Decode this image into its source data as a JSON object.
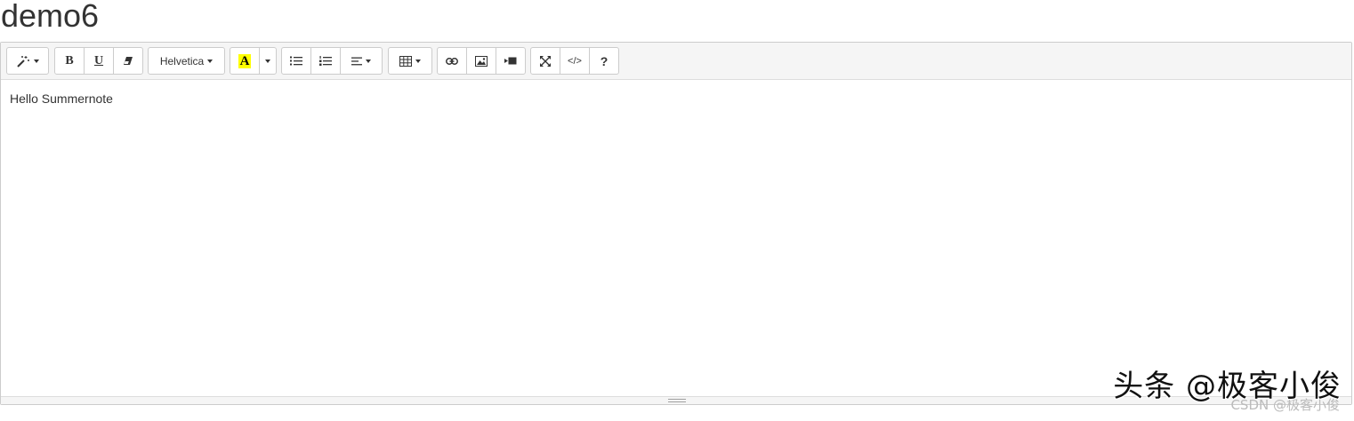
{
  "page": {
    "title": "demo6"
  },
  "toolbar": {
    "style_button": {
      "icon": "magic-wand-icon"
    },
    "bold_label": "B",
    "underline_label": "U",
    "clear_format": {
      "icon": "eraser-icon"
    },
    "font_name": "Helvetica",
    "color_label": "A",
    "color_highlight": "#ffff00",
    "unordered_list": {
      "icon": "list-ul-icon"
    },
    "ordered_list": {
      "icon": "list-ol-icon"
    },
    "paragraph": {
      "icon": "align-left-icon"
    },
    "table": {
      "icon": "table-icon"
    },
    "link": {
      "icon": "link-icon"
    },
    "picture": {
      "icon": "picture-icon"
    },
    "video": {
      "icon": "video-icon"
    },
    "fullscreen": {
      "icon": "arrows-expand-icon"
    },
    "codeview_label": "</>",
    "help_label": "?"
  },
  "editor": {
    "content": "Hello Summernote"
  },
  "watermark": {
    "main": "头条 @极客小俊",
    "sub": "CSDN @极客小俊"
  }
}
